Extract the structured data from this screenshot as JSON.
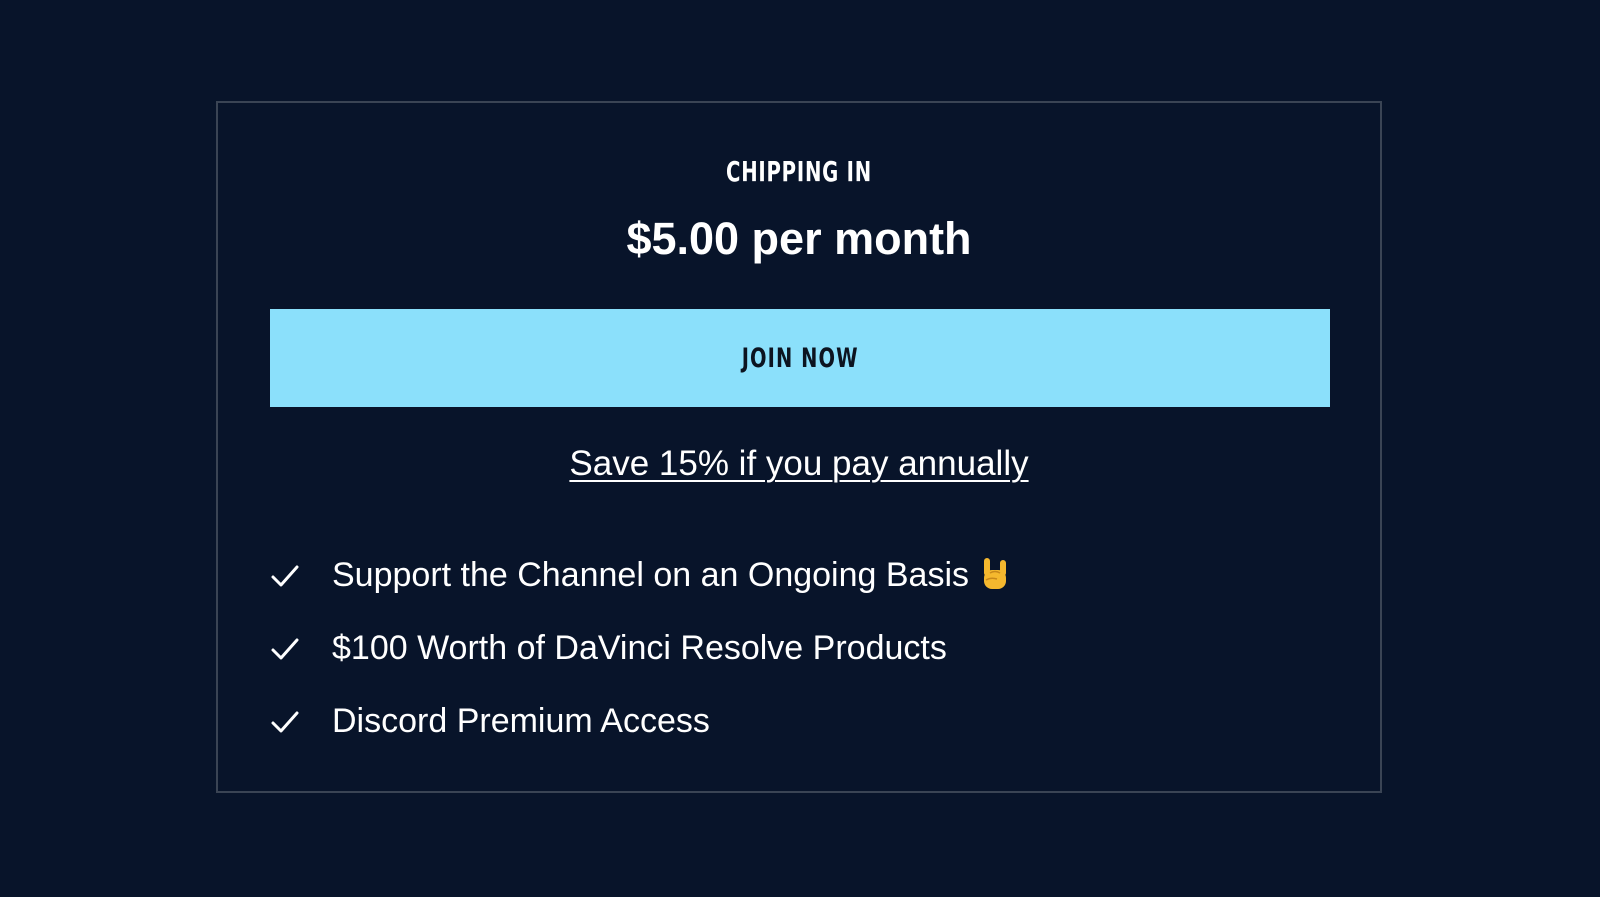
{
  "tier": {
    "name": "CHIPPING IN",
    "price": "$5.00 per month"
  },
  "cta": {
    "join_label": "JOIN NOW",
    "annual_link": "Save 15% if you pay annually"
  },
  "benefits": [
    {
      "text": "Support the Channel on an Ongoing Basis",
      "icon": "check-icon",
      "emoji": "rock-on-hand-emoji"
    },
    {
      "text": "$100 Worth of DaVinci Resolve Products",
      "icon": "check-icon"
    },
    {
      "text": "Discord Premium Access",
      "icon": "check-icon"
    }
  ],
  "colors": {
    "background": "#08142a",
    "card_border": "#3a4454",
    "button": "#8be0fb",
    "button_text": "#0c1420",
    "text": "#ffffff"
  }
}
